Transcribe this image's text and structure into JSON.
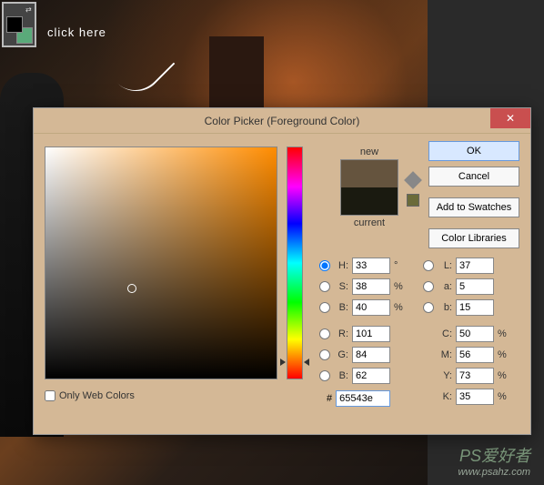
{
  "annotation": {
    "text": "click here"
  },
  "dialog": {
    "title": "Color Picker (Foreground Color)",
    "close": "✕",
    "preview": {
      "new_label": "new",
      "current_label": "current",
      "new_color": "#65543e",
      "current_color": "#1a1a10"
    },
    "buttons": {
      "ok": "OK",
      "cancel": "Cancel",
      "swatches": "Add to Swatches",
      "libraries": "Color Libraries"
    },
    "fields": {
      "H": {
        "label": "H:",
        "value": "33",
        "unit": "°"
      },
      "S": {
        "label": "S:",
        "value": "38",
        "unit": "%"
      },
      "Bhsb": {
        "label": "B:",
        "value": "40",
        "unit": "%"
      },
      "R": {
        "label": "R:",
        "value": "101",
        "unit": ""
      },
      "G": {
        "label": "G:",
        "value": "84",
        "unit": ""
      },
      "Brgb": {
        "label": "B:",
        "value": "62",
        "unit": ""
      },
      "L": {
        "label": "L:",
        "value": "37",
        "unit": ""
      },
      "a": {
        "label": "a:",
        "value": "5",
        "unit": ""
      },
      "blab": {
        "label": "b:",
        "value": "15",
        "unit": ""
      },
      "C": {
        "label": "C:",
        "value": "50",
        "unit": "%"
      },
      "M": {
        "label": "M:",
        "value": "56",
        "unit": "%"
      },
      "Y": {
        "label": "Y:",
        "value": "73",
        "unit": "%"
      },
      "K": {
        "label": "K:",
        "value": "35",
        "unit": "%"
      }
    },
    "hex": {
      "label": "#",
      "value": "65543e"
    },
    "webonly": "Only Web Colors"
  },
  "watermark": {
    "brand": "PS爱好者",
    "url": "www.psahz.com"
  }
}
